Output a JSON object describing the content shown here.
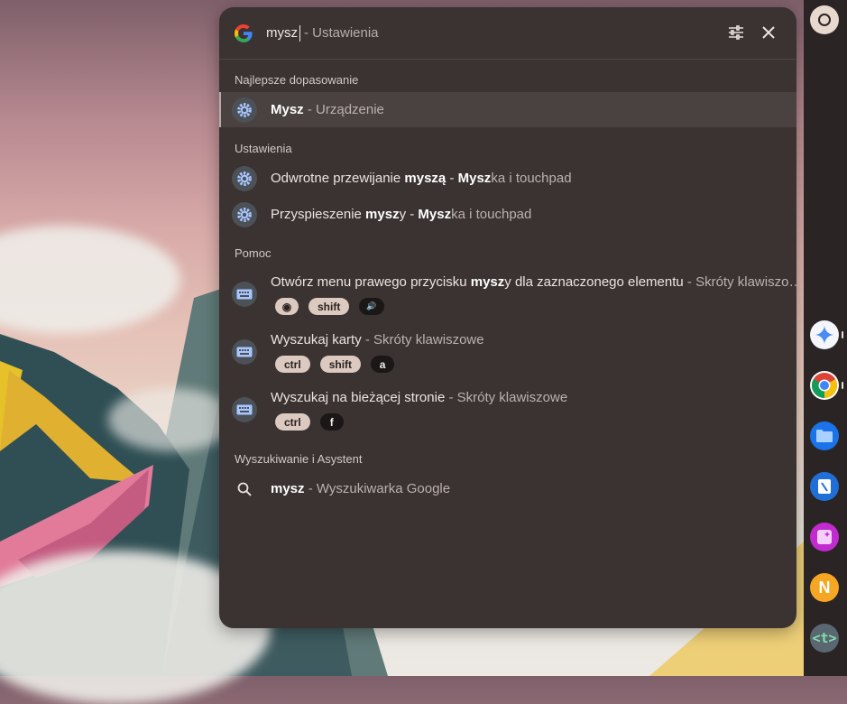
{
  "search": {
    "query": "mysz",
    "autocomplete": " - Ustawienia"
  },
  "sections": {
    "best_match": "Najlepsze dopasowanie",
    "settings": "Ustawienia",
    "help": "Pomoc",
    "search_assistant": "Wyszukiwanie i Asystent"
  },
  "best": {
    "bold": "Mysz",
    "rest": " - Urządzenie"
  },
  "settings_results": [
    {
      "pre": "Odwrotne przewijanie ",
      "bold": "myszą",
      "mid": " - ",
      "bold2": "Mysz",
      "post": "ka i touchpad"
    },
    {
      "pre": "Przyspieszenie ",
      "bold": "mysz",
      "mid": "y - ",
      "bold2": "Mysz",
      "post": "ka i touchpad"
    }
  ],
  "help_results": [
    {
      "pre": "Otwórz menu prawego przycisku ",
      "bold": "mysz",
      "post": "y dla zaznaczonego elementu",
      "sub": " - Skróty klawiszo…",
      "keys": [
        "◉",
        "shift",
        "🔊"
      ]
    },
    {
      "pre": "Wyszukaj karty",
      "bold": "",
      "post": "",
      "sub": " - Skróty klawiszowe",
      "keys": [
        "ctrl",
        "shift",
        "a"
      ]
    },
    {
      "pre": "Wyszukaj na bieżącej stronie",
      "bold": "",
      "post": "",
      "sub": " - Skróty klawiszowe",
      "keys": [
        "ctrl",
        "f"
      ]
    }
  ],
  "web": {
    "bold": "mysz",
    "rest": " - Wyszukiwarka Google"
  },
  "shelf": {
    "launcher_icon": "circle-icon",
    "apps": [
      "gemini-icon",
      "chrome-icon",
      "files-icon",
      "docs-icon",
      "photos-editor-icon",
      "notes-icon",
      "terminal-icon"
    ],
    "terminal_glyph": "<t>",
    "notes_glyph": "N"
  },
  "colors": {
    "panel": "#3a3331",
    "selected": "#4a4240",
    "key_light": "#dcc9bf",
    "key_dark": "#1b1717"
  }
}
